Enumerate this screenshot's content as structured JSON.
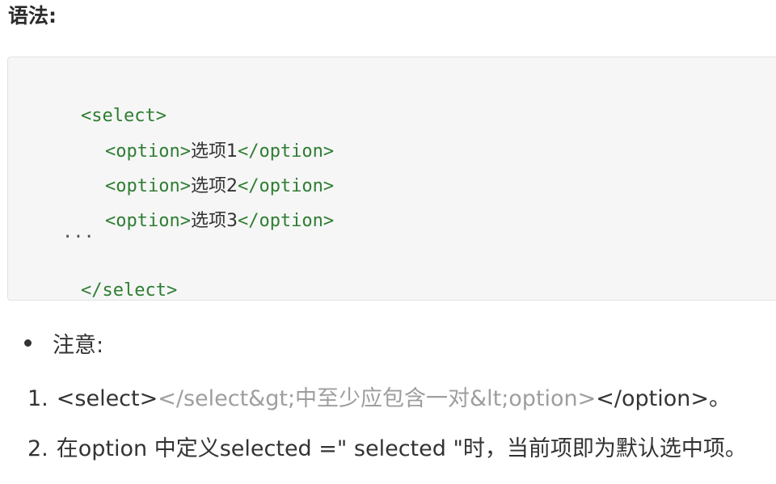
{
  "heading": "语法:",
  "code": {
    "lines": [
      "<select>",
      "  <option>选项1</option>",
      "  <option>选项2</option>",
      "  <option>选项3</option>",
      "  ...",
      "</select>"
    ],
    "select_open": "<select>",
    "option_open": "<option>",
    "option_close": "</option>",
    "option_labels": [
      "选项1",
      "选项2",
      "选项3"
    ],
    "ellipsis": "...",
    "select_close": "</select>"
  },
  "note": {
    "bullet_label": "注意:"
  },
  "list": {
    "item1": {
      "number": "1.",
      "part1": "<select>",
      "part2": "</select&gt;中至少应包含一对&lt;option>",
      "part3": "</option>。"
    },
    "item2": {
      "number": "2.",
      "text": "在option 中定义selected =\" selected \"时，当前项即为默认选中项。"
    }
  },
  "colors": {
    "code_tag": "#2e7d32",
    "code_bg": "#f6f6f6",
    "text": "#333333",
    "faded_text": "#9e9e9e"
  }
}
